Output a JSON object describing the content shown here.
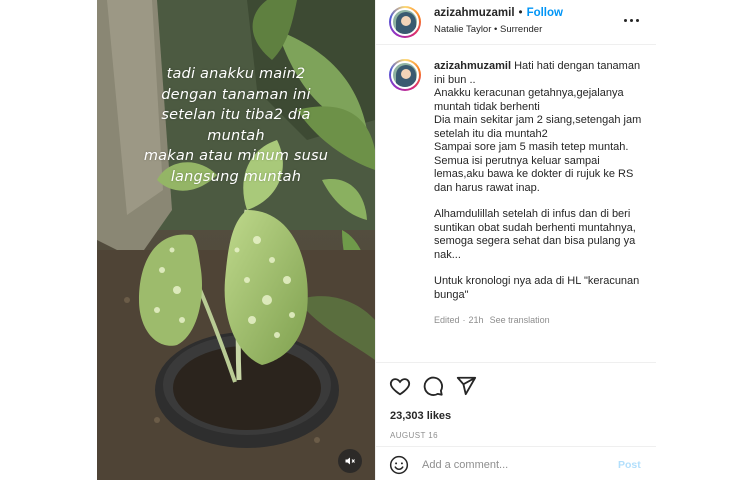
{
  "post": {
    "username": "azizahmuzamil",
    "separator": "•",
    "follow_label": "Follow",
    "audio": "Natalie Taylor • Surrender",
    "more_icon": "more-horizontal-icon"
  },
  "media": {
    "overlay_text": "tadi anakku main2\ndengan tanaman ini\nsetelan itu tiba2 dia\nmuntah\nmakan atau minum susu\nlangsung muntah",
    "mute_icon": "speaker-muted-icon"
  },
  "caption": {
    "username": "azizahmuzamil",
    "lines": [
      "Hati hati dengan tanaman ini bun ..",
      "Anakku keracunan getahnya,gejalanya muntah tidak berhenti",
      "Dia main sekitar jam 2 siang,setengah jam setelah itu dia muntah2",
      "Sampai sore jam 5 masih tetep muntah.",
      "Semua isi perutnya keluar sampai lemas,aku bawa ke dokter di rujuk ke RS dan harus rawat inap."
    ],
    "paragraph2": "Alhamdulillah setelah di infus dan di beri suntikan obat sudah berhenti muntahnya, semoga segera sehat dan bisa pulang ya nak...",
    "paragraph3": "Untuk kronologi nya ada di HL \"keracunan bunga\"",
    "edited": "Edited",
    "age": "21h",
    "see_translation": "See translation"
  },
  "actions": {
    "like_icon": "heart-icon",
    "comment_icon": "comment-bubble-icon",
    "share_icon": "paper-plane-icon",
    "likes": "23,303 likes",
    "date": "AUGUST 16"
  },
  "comment": {
    "emoji_icon": "emoji-smile-icon",
    "placeholder": "Add a comment...",
    "post_label": "Post"
  },
  "colors": {
    "accent": "#0095f6",
    "post_disabled": "#b2dffc",
    "muted_text": "#8e8e8e",
    "border": "#efefef"
  }
}
